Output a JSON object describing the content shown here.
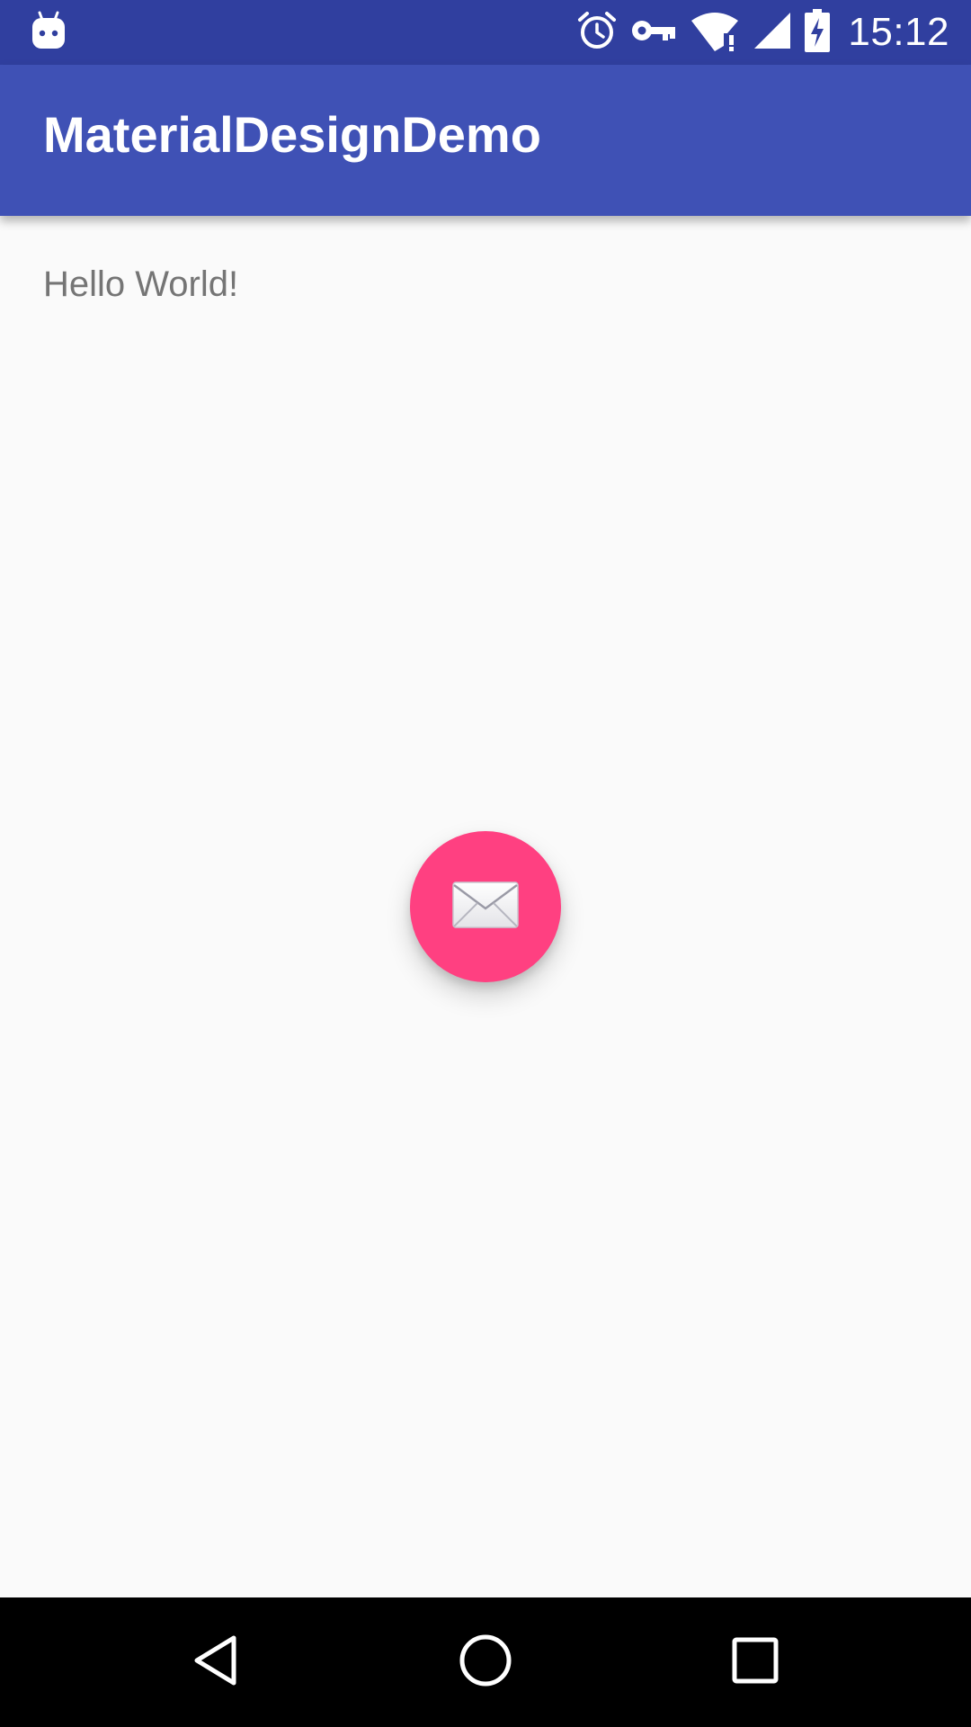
{
  "status_bar": {
    "time": "15:12",
    "icons": [
      "android-notification-icon",
      "alarm-icon",
      "vpn-key-icon",
      "wifi-alert-icon",
      "cell-signal-icon",
      "battery-charging-icon"
    ],
    "background_color": "#303f9f"
  },
  "app_bar": {
    "title": "MaterialDesignDemo",
    "background_color": "#3f51b5"
  },
  "content": {
    "text": "Hello World!"
  },
  "fab": {
    "icon": "email-envelope-icon",
    "color": "#ff4081"
  },
  "nav_bar": {
    "buttons": [
      "back-icon",
      "home-icon",
      "recents-icon"
    ]
  }
}
